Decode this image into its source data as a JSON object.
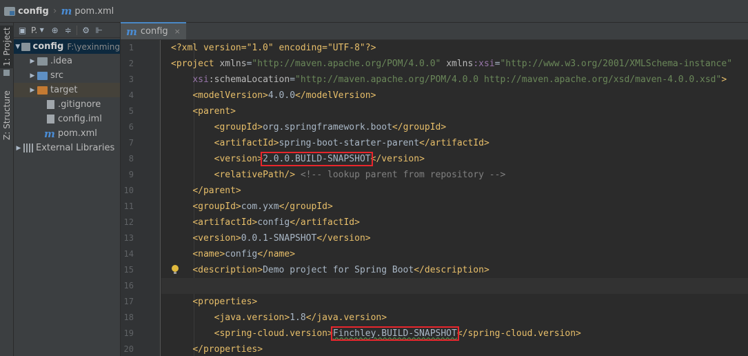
{
  "breadcrumb": {
    "project": "config",
    "file": "pom.xml",
    "file_icon": "m"
  },
  "left_strip": {
    "project_tab": "1: Project",
    "structure_tab": "Z: Structure"
  },
  "project_panel": {
    "view_selector": "P.",
    "tree": [
      {
        "label": "config",
        "hint": "F:\\yexinming",
        "kind": "root"
      },
      {
        "label": ".idea",
        "kind": "folder"
      },
      {
        "label": "src",
        "kind": "folder"
      },
      {
        "label": "target",
        "kind": "folder-excluded"
      },
      {
        "label": ".gitignore",
        "kind": "file"
      },
      {
        "label": "config.iml",
        "kind": "file"
      },
      {
        "label": "pom.xml",
        "kind": "maven"
      },
      {
        "label": "External Libraries",
        "kind": "library"
      }
    ]
  },
  "editor": {
    "tab": {
      "icon": "m",
      "label": "config",
      "close": "×"
    },
    "line_numbers": [
      "1",
      "2",
      "3",
      "4",
      "5",
      "6",
      "7",
      "8",
      "9",
      "10",
      "11",
      "12",
      "13",
      "14",
      "15",
      "16",
      "17",
      "18",
      "19",
      "20"
    ],
    "code": {
      "l1_decl": "<?xml version=\"1.0\" encoding=\"UTF-8\"?>",
      "project_tag": "<project",
      "xmlns_attr": "xmlns",
      "xmlns_val": "\"http://maven.apache.org/POM/4.0.0\"",
      "xmlns_xsi_ns": "xmlns",
      "xmlns_xsi_attr": ":xsi",
      "xmlns_xsi_val": "\"http://www.w3.org/2001/XMLSchema-instance\"",
      "xsi_ns": "xsi",
      "xsi_attr": ":schemaLocation",
      "xsi_val": "\"http://maven.apache.org/POM/4.0.0 http://maven.apache.org/xsd/maven-4.0.0.xsd\"",
      "gt": ">",
      "model_open": "<modelVersion>",
      "model_text": "4.0.0",
      "model_close": "</modelVersion>",
      "parent_open": "<parent>",
      "group_open": "<groupId>",
      "group_parent": "org.springframework.boot",
      "group_close": "</groupId>",
      "artifact_open": "<artifactId>",
      "artifact_parent": "spring-boot-starter-parent",
      "artifact_close": "</artifactId>",
      "version_open": "<version>",
      "version_parent": "2.0.0.BUILD-SNAPSHOT",
      "version_close": "</version>",
      "relpath": "<relativePath/>",
      "relpath_comment": "<!-- lookup parent from repository -->",
      "parent_close": "</parent>",
      "group_project": "com.yxm",
      "artifact_project": "config",
      "version_project": "0.0.1-SNAPSHOT",
      "name_open": "<name>",
      "name_text": "config",
      "name_close": "</name>",
      "desc_open": "<description>",
      "desc_text": "Demo project for Spring Boot",
      "desc_close": "</description>",
      "props_open": "<properties>",
      "java_open": "<java.version>",
      "java_text": "1.8",
      "java_close": "</java.version>",
      "scv_open": "<spring-cloud.version>",
      "scv_text": "Finchley.BUILD-SNAPSHOT",
      "scv_close": "</spring-cloud.version>",
      "props_close": "</properties>"
    }
  },
  "colors": {
    "highlight_box": "#e8262c",
    "tag": "#e8bf6a",
    "value": "#6a8759",
    "comment": "#808080"
  }
}
